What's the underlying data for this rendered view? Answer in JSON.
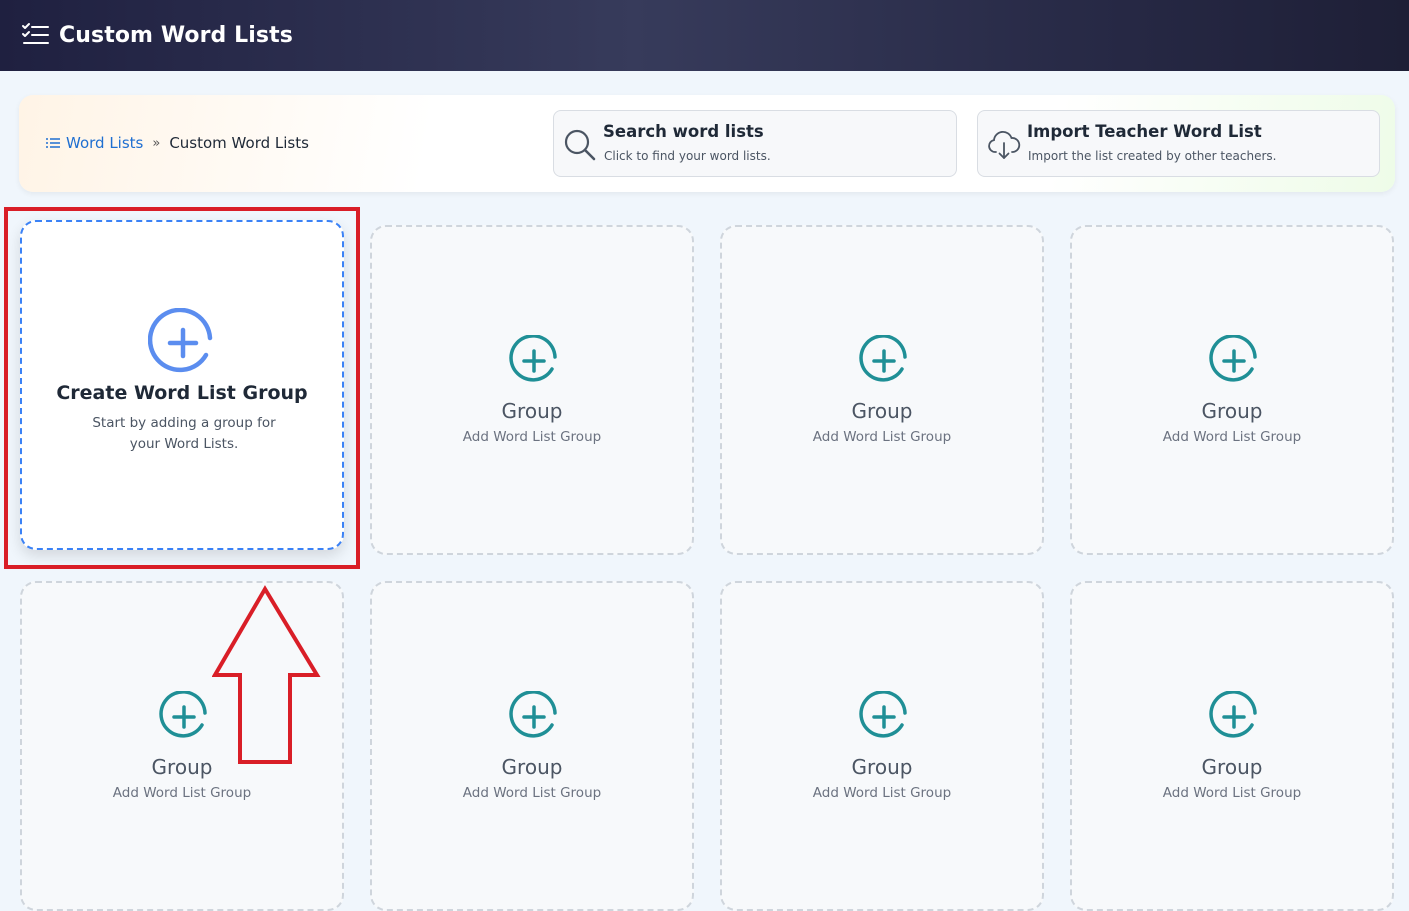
{
  "header": {
    "title": "Custom Word Lists",
    "menu_icon": "list-checks-icon"
  },
  "breadcrumb": {
    "link_label": "Word Lists",
    "separator": "»",
    "current": "Custom Word Lists"
  },
  "search_card": {
    "title": "Search word lists",
    "subtitle": "Click to find your word lists."
  },
  "import_card": {
    "title": "Import Teacher Word List",
    "subtitle": "Import the list created by other teachers."
  },
  "create_tile": {
    "title": "Create Word List Group",
    "subtitle": "Start by adding a group for your Word Lists."
  },
  "group_tiles": [
    {
      "title": "Group",
      "subtitle": "Add Word List Group"
    },
    {
      "title": "Group",
      "subtitle": "Add Word List Group"
    },
    {
      "title": "Group",
      "subtitle": "Add Word List Group"
    },
    {
      "title": "Group",
      "subtitle": "Add Word List Group"
    },
    {
      "title": "Group",
      "subtitle": "Add Word List Group"
    },
    {
      "title": "Group",
      "subtitle": "Add Word List Group"
    },
    {
      "title": "Group",
      "subtitle": "Add Word List Group"
    }
  ],
  "colors": {
    "create_accent": "#3b82f6",
    "group_icon": "#1f8f96",
    "highlight": "#d91e27"
  }
}
